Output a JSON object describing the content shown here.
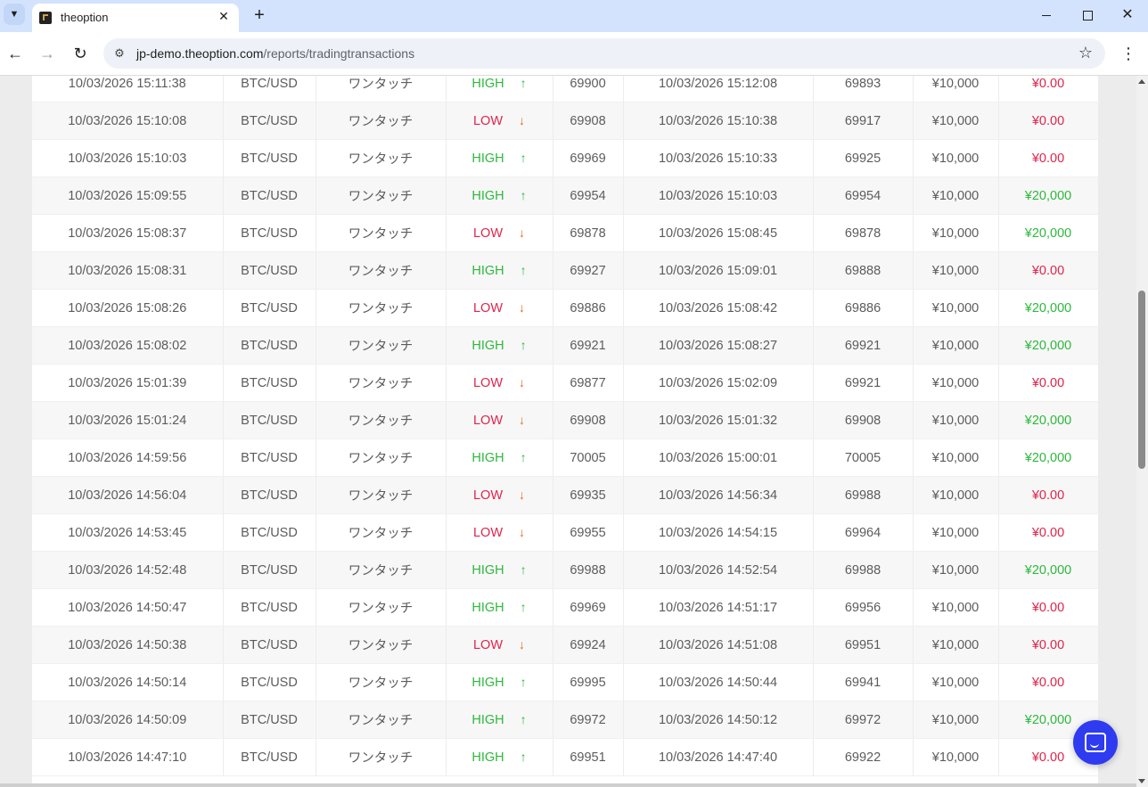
{
  "browser": {
    "tab_title": "theoption",
    "url_host": "jp-demo.theoption.com",
    "url_path": "/reports/tradingtransactions"
  },
  "table": {
    "rows": [
      {
        "open_time": "10/03/2026 15:11:38",
        "asset": "BTC/USD",
        "type": "ワンタッチ",
        "direction": "HIGH",
        "open_price": "69900",
        "close_time": "10/03/2026 15:12:08",
        "close_price": "69893",
        "amount": "¥10,000",
        "payout": "¥0.00"
      },
      {
        "open_time": "10/03/2026 15:10:08",
        "asset": "BTC/USD",
        "type": "ワンタッチ",
        "direction": "LOW",
        "open_price": "69908",
        "close_time": "10/03/2026 15:10:38",
        "close_price": "69917",
        "amount": "¥10,000",
        "payout": "¥0.00"
      },
      {
        "open_time": "10/03/2026 15:10:03",
        "asset": "BTC/USD",
        "type": "ワンタッチ",
        "direction": "HIGH",
        "open_price": "69969",
        "close_time": "10/03/2026 15:10:33",
        "close_price": "69925",
        "amount": "¥10,000",
        "payout": "¥0.00"
      },
      {
        "open_time": "10/03/2026 15:09:55",
        "asset": "BTC/USD",
        "type": "ワンタッチ",
        "direction": "HIGH",
        "open_price": "69954",
        "close_time": "10/03/2026 15:10:03",
        "close_price": "69954",
        "amount": "¥10,000",
        "payout": "¥20,000"
      },
      {
        "open_time": "10/03/2026 15:08:37",
        "asset": "BTC/USD",
        "type": "ワンタッチ",
        "direction": "LOW",
        "open_price": "69878",
        "close_time": "10/03/2026 15:08:45",
        "close_price": "69878",
        "amount": "¥10,000",
        "payout": "¥20,000"
      },
      {
        "open_time": "10/03/2026 15:08:31",
        "asset": "BTC/USD",
        "type": "ワンタッチ",
        "direction": "HIGH",
        "open_price": "69927",
        "close_time": "10/03/2026 15:09:01",
        "close_price": "69888",
        "amount": "¥10,000",
        "payout": "¥0.00"
      },
      {
        "open_time": "10/03/2026 15:08:26",
        "asset": "BTC/USD",
        "type": "ワンタッチ",
        "direction": "LOW",
        "open_price": "69886",
        "close_time": "10/03/2026 15:08:42",
        "close_price": "69886",
        "amount": "¥10,000",
        "payout": "¥20,000"
      },
      {
        "open_time": "10/03/2026 15:08:02",
        "asset": "BTC/USD",
        "type": "ワンタッチ",
        "direction": "HIGH",
        "open_price": "69921",
        "close_time": "10/03/2026 15:08:27",
        "close_price": "69921",
        "amount": "¥10,000",
        "payout": "¥20,000"
      },
      {
        "open_time": "10/03/2026 15:01:39",
        "asset": "BTC/USD",
        "type": "ワンタッチ",
        "direction": "LOW",
        "open_price": "69877",
        "close_time": "10/03/2026 15:02:09",
        "close_price": "69921",
        "amount": "¥10,000",
        "payout": "¥0.00"
      },
      {
        "open_time": "10/03/2026 15:01:24",
        "asset": "BTC/USD",
        "type": "ワンタッチ",
        "direction": "LOW",
        "open_price": "69908",
        "close_time": "10/03/2026 15:01:32",
        "close_price": "69908",
        "amount": "¥10,000",
        "payout": "¥20,000"
      },
      {
        "open_time": "10/03/2026 14:59:56",
        "asset": "BTC/USD",
        "type": "ワンタッチ",
        "direction": "HIGH",
        "open_price": "70005",
        "close_time": "10/03/2026 15:00:01",
        "close_price": "70005",
        "amount": "¥10,000",
        "payout": "¥20,000"
      },
      {
        "open_time": "10/03/2026 14:56:04",
        "asset": "BTC/USD",
        "type": "ワンタッチ",
        "direction": "LOW",
        "open_price": "69935",
        "close_time": "10/03/2026 14:56:34",
        "close_price": "69988",
        "amount": "¥10,000",
        "payout": "¥0.00"
      },
      {
        "open_time": "10/03/2026 14:53:45",
        "asset": "BTC/USD",
        "type": "ワンタッチ",
        "direction": "LOW",
        "open_price": "69955",
        "close_time": "10/03/2026 14:54:15",
        "close_price": "69964",
        "amount": "¥10,000",
        "payout": "¥0.00"
      },
      {
        "open_time": "10/03/2026 14:52:48",
        "asset": "BTC/USD",
        "type": "ワンタッチ",
        "direction": "HIGH",
        "open_price": "69988",
        "close_time": "10/03/2026 14:52:54",
        "close_price": "69988",
        "amount": "¥10,000",
        "payout": "¥20,000"
      },
      {
        "open_time": "10/03/2026 14:50:47",
        "asset": "BTC/USD",
        "type": "ワンタッチ",
        "direction": "HIGH",
        "open_price": "69969",
        "close_time": "10/03/2026 14:51:17",
        "close_price": "69956",
        "amount": "¥10,000",
        "payout": "¥0.00"
      },
      {
        "open_time": "10/03/2026 14:50:38",
        "asset": "BTC/USD",
        "type": "ワンタッチ",
        "direction": "LOW",
        "open_price": "69924",
        "close_time": "10/03/2026 14:51:08",
        "close_price": "69951",
        "amount": "¥10,000",
        "payout": "¥0.00"
      },
      {
        "open_time": "10/03/2026 14:50:14",
        "asset": "BTC/USD",
        "type": "ワンタッチ",
        "direction": "HIGH",
        "open_price": "69995",
        "close_time": "10/03/2026 14:50:44",
        "close_price": "69941",
        "amount": "¥10,000",
        "payout": "¥0.00"
      },
      {
        "open_time": "10/03/2026 14:50:09",
        "asset": "BTC/USD",
        "type": "ワンタッチ",
        "direction": "HIGH",
        "open_price": "69972",
        "close_time": "10/03/2026 14:50:12",
        "close_price": "69972",
        "amount": "¥10,000",
        "payout": "¥20,000"
      },
      {
        "open_time": "10/03/2026 14:47:10",
        "asset": "BTC/USD",
        "type": "ワンタッチ",
        "direction": "HIGH",
        "open_price": "69951",
        "close_time": "10/03/2026 14:47:40",
        "close_price": "69922",
        "amount": "¥10,000",
        "payout": "¥0.00"
      }
    ]
  },
  "icons": {
    "high_arrow": "arrow-up-icon",
    "low_arrow": "arrow-down-icon",
    "chat": "chat-icon"
  },
  "colors": {
    "high": "#2db83d",
    "low": "#e0244b",
    "low_arrow": "#e36b1c",
    "chat_button": "#2f3bf0"
  }
}
